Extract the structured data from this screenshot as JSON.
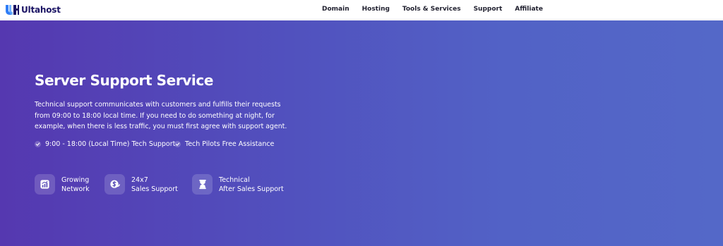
{
  "brand": {
    "name": "Ultahost"
  },
  "nav": {
    "items": [
      {
        "label": "Domain"
      },
      {
        "label": "Hosting"
      },
      {
        "label": "Tools & Services"
      },
      {
        "label": "Support"
      },
      {
        "label": "Affiliate"
      }
    ]
  },
  "hero": {
    "title": "Server Support Service",
    "description": "Technical support communicates with customers and fulfills their requests from 09:00 to 18:00 local time. If you need to do something at night, for example, when there is less traffic, you must first agree with support agent.",
    "checks": [
      {
        "label": "9:00 - 18:00 (Local Time) Tech Support",
        "icon": "check-icon"
      },
      {
        "label": "Tech Pilots Free Assistance",
        "icon": "check-icon"
      }
    ],
    "features": [
      {
        "line1": "Growing",
        "line2": "Network",
        "icon": "chart-growth-icon"
      },
      {
        "line1": "24x7",
        "line2": "Sales Support",
        "icon": "dollar-coin-icon"
      },
      {
        "line1": "Technical",
        "line2": "After Sales Support",
        "icon": "hourglass-icon"
      }
    ]
  },
  "colors": {
    "brand_blue": "#2f7df6",
    "brand_dark": "#1b1464",
    "hero_start": "#5538b0",
    "hero_end": "#5468c8",
    "text_light": "#ffffff"
  }
}
